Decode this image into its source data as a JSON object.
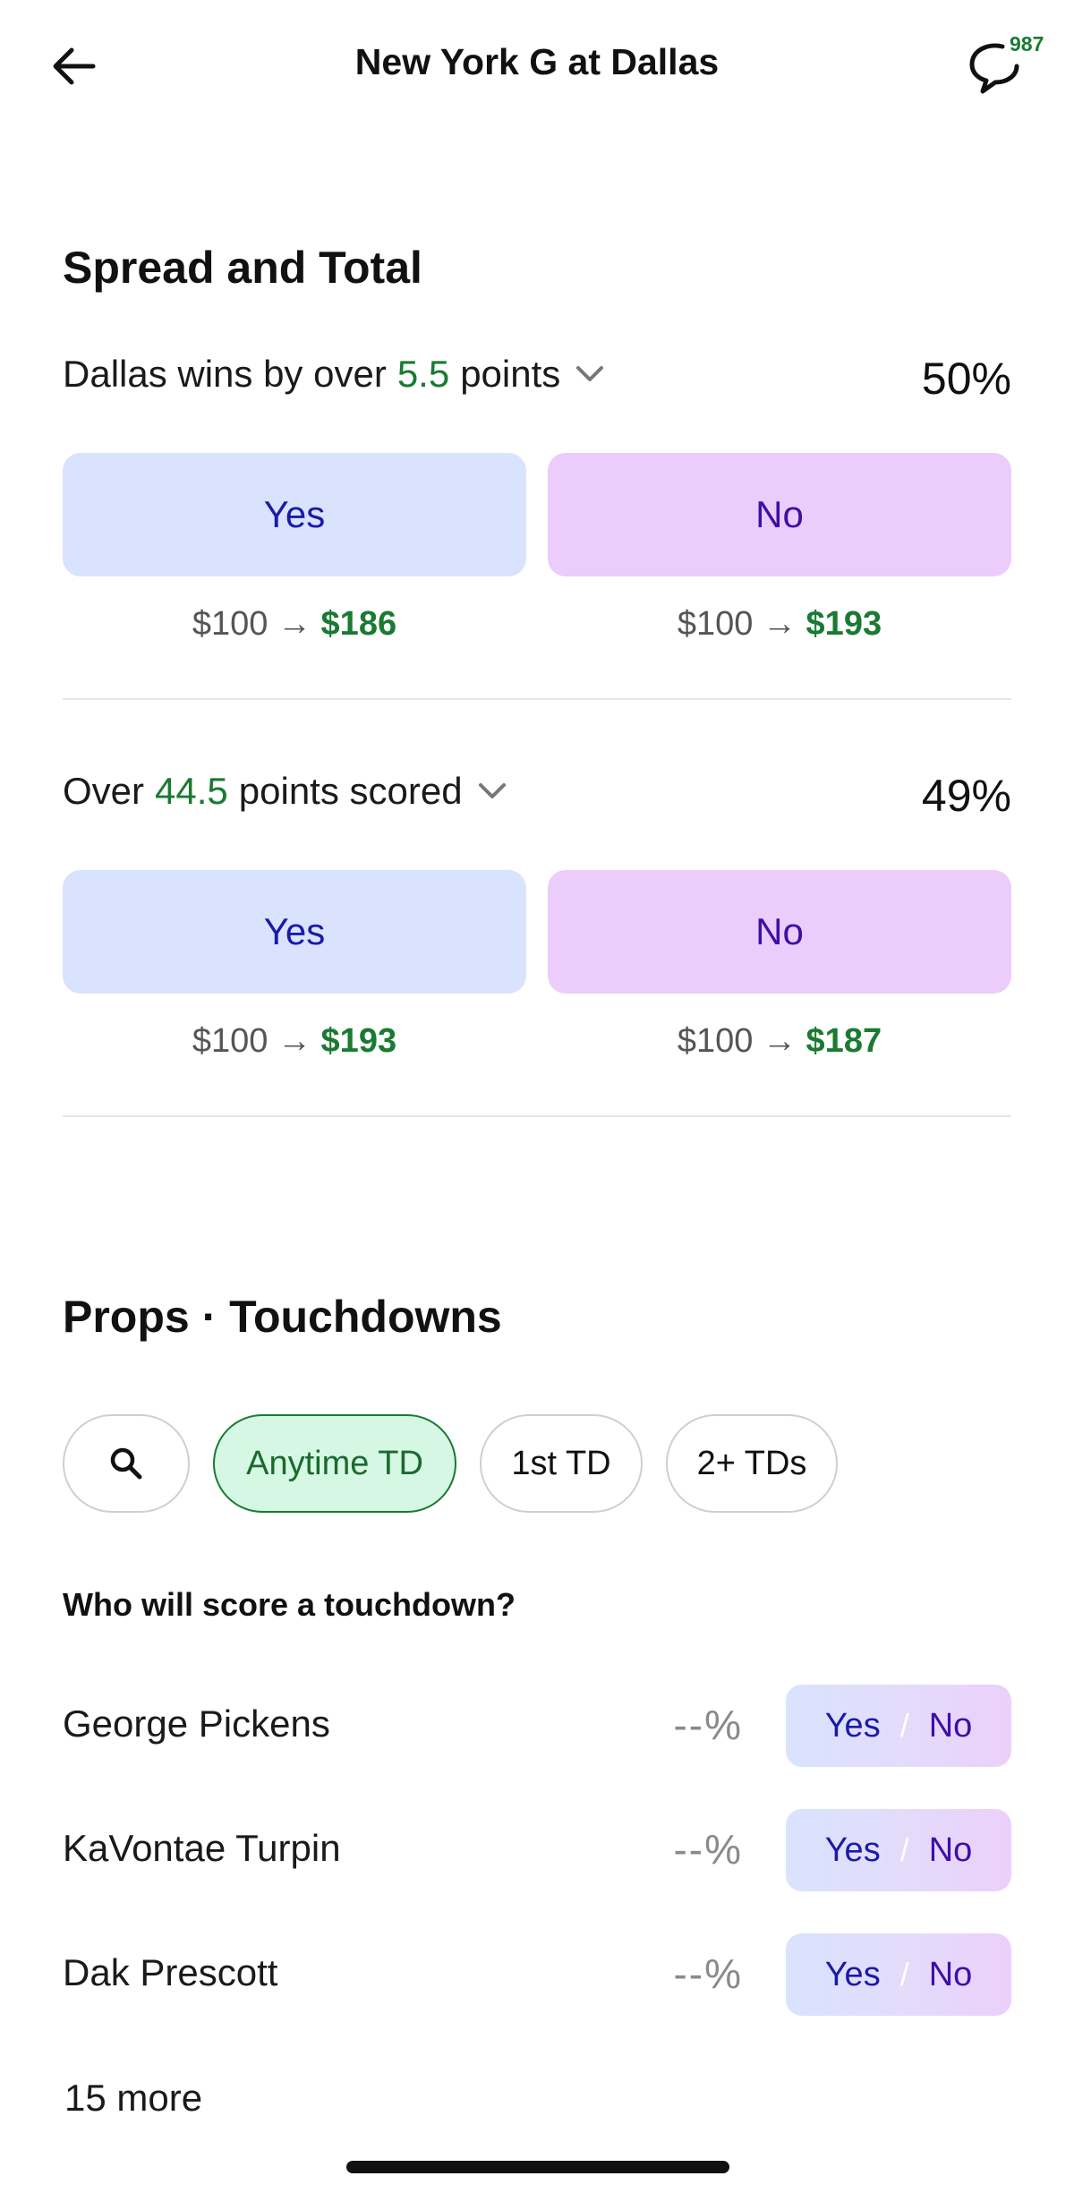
{
  "header": {
    "title": "New York G at Dallas",
    "chat_count": "987"
  },
  "spread_total": {
    "title": "Spread and Total",
    "markets": [
      {
        "q_prefix": "Dallas wins by over",
        "q_value": "5.5",
        "q_suffix": "points",
        "percent": "50%",
        "yes_label": "Yes",
        "no_label": "No",
        "yes_stake": "$100 →",
        "yes_payout": "$186",
        "no_stake": "$100 →",
        "no_payout": "$193"
      },
      {
        "q_prefix": "Over",
        "q_value": "44.5",
        "q_suffix": "points scored",
        "percent": "49%",
        "yes_label": "Yes",
        "no_label": "No",
        "yes_stake": "$100 →",
        "yes_payout": "$193",
        "no_stake": "$100 →",
        "no_payout": "$187"
      }
    ]
  },
  "props": {
    "title": "Props · Touchdowns",
    "chips": [
      {
        "label": "Anytime TD",
        "active": true
      },
      {
        "label": "1st TD",
        "active": false
      },
      {
        "label": "2+ TDs",
        "active": false
      }
    ],
    "question": "Who will score a touchdown?",
    "players": [
      {
        "name": "George Pickens",
        "percent": "--%",
        "yes": "Yes",
        "slash": "/",
        "no": "No"
      },
      {
        "name": "KaVontae Turpin",
        "percent": "--%",
        "yes": "Yes",
        "slash": "/",
        "no": "No"
      },
      {
        "name": "Dak Prescott",
        "percent": "--%",
        "yes": "Yes",
        "slash": "/",
        "no": "No"
      }
    ],
    "more_label": "15 more"
  },
  "colors": {
    "accent_green": "#1a7a32",
    "yes_bg": "#d9e3fd",
    "no_bg": "#ebccfb",
    "yes_text": "#1a1aa8",
    "no_text": "#3d0fa8"
  },
  "icons": [
    "back-arrow-icon",
    "chat-bubble-icon",
    "chevron-down-icon",
    "search-icon"
  ]
}
